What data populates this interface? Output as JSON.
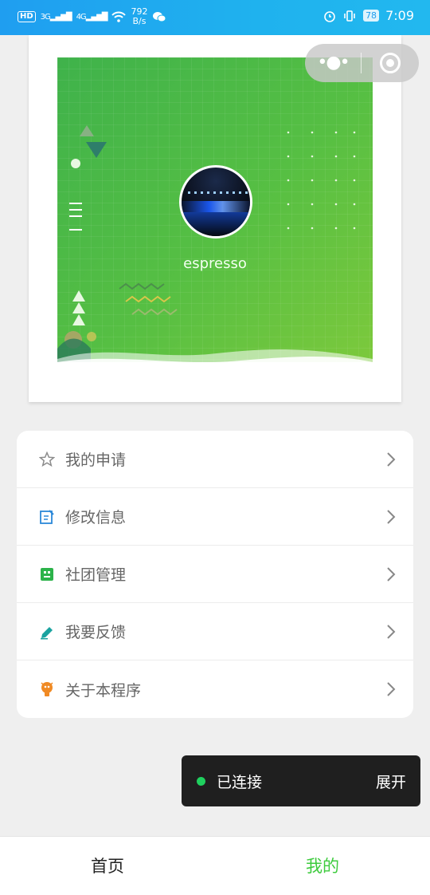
{
  "status_bar": {
    "left": {
      "hd": "HD",
      "signal_1": "3G",
      "signal_2": "4G",
      "speed_value": "792",
      "speed_unit": "B/s"
    },
    "right": {
      "battery": "78",
      "time": "7:09"
    }
  },
  "profile": {
    "username": "espresso"
  },
  "menu": {
    "items": [
      {
        "label": "我的申请",
        "icon": "star-icon",
        "color": "#8c8c8c"
      },
      {
        "label": "修改信息",
        "icon": "edit-icon",
        "color": "#2b88d8"
      },
      {
        "label": "社团管理",
        "icon": "robot-icon",
        "color": "#2cb34a"
      },
      {
        "label": "我要反馈",
        "icon": "pencil-icon",
        "color": "#1aa3a0"
      },
      {
        "label": "关于本程序",
        "icon": "bulb-icon",
        "color": "#f08a24"
      }
    ]
  },
  "toast": {
    "status": "已连接",
    "expand": "展开",
    "dot_color": "#1fd05e"
  },
  "tabbar": {
    "home": "首页",
    "mine": "我的",
    "active_color": "#3ecb3e"
  }
}
